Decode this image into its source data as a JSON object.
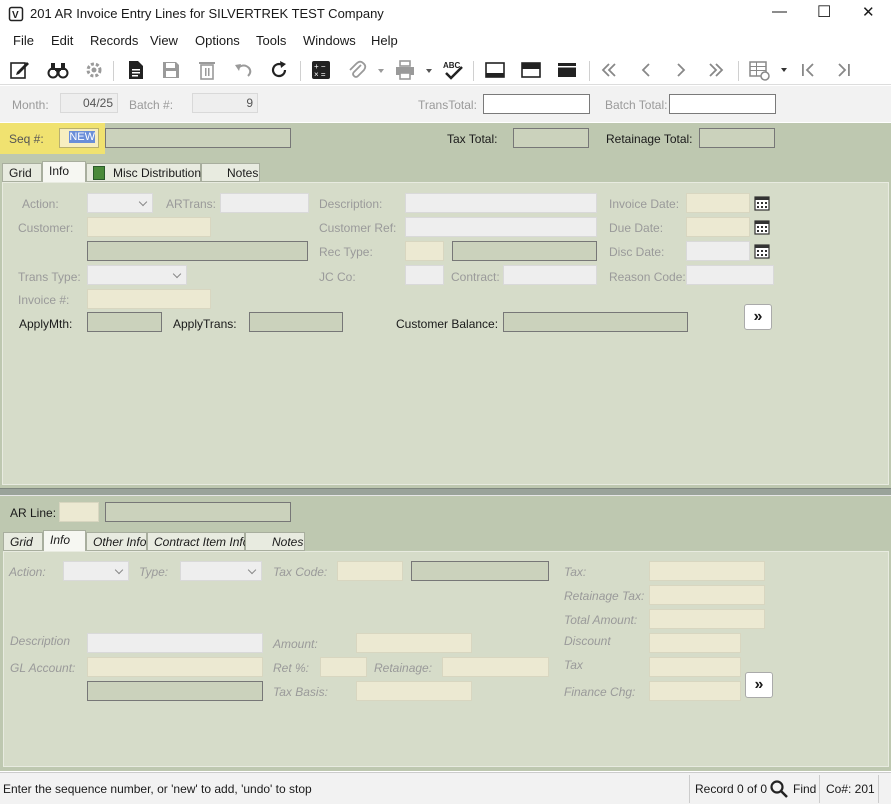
{
  "window": {
    "title": "201 AR Invoice Entry Lines for SILVERTREK TEST Company",
    "controls": {
      "minimize": "—",
      "maximize": "☐",
      "close": "✕"
    }
  },
  "menu": [
    "File",
    "Edit",
    "Records",
    "View",
    "Options",
    "Tools",
    "Windows",
    "Help"
  ],
  "toolbar_icons": [
    "edit-icon",
    "binoculars-icon",
    "gear-icon",
    "new-record-icon",
    "save-icon",
    "delete-icon",
    "undo-icon",
    "refresh-icon",
    "calculator-icon",
    "attach-icon",
    "print-icon",
    "spellcheck-icon",
    "layout-bottom-icon",
    "layout-top-icon",
    "layout-full-icon",
    "first-double-icon",
    "prev-icon",
    "next-icon",
    "last-double-icon",
    "grid-settings-icon",
    "first-record-icon",
    "last-record-icon"
  ],
  "batch": {
    "month_label": "Month:",
    "month_value": "04/25",
    "batch_label": "Batch #:",
    "batch_value": "9",
    "trans_total_label": "TransTotal:",
    "batch_total_label": "Batch Total:"
  },
  "header": {
    "seq_label": "Seq #:",
    "seq_value": "NEW",
    "tax_total_label": "Tax Total:",
    "retainage_total_label": "Retainage Total:"
  },
  "upper_tabs": [
    "Grid",
    "Info",
    "Misc Distributions",
    "Notes"
  ],
  "upper_form": {
    "action": "Action:",
    "artrans": "ARTrans:",
    "description": "Description:",
    "invoice_date": "Invoice Date:",
    "customer": "Customer:",
    "customer_ref": "Customer Ref:",
    "due_date": "Due Date:",
    "rec_type": "Rec Type:",
    "disc_date": "Disc Date:",
    "trans_type": "Trans Type:",
    "jc_co": "JC Co:",
    "contract": "Contract:",
    "reason_code": "Reason Code:",
    "invoice_no": "Invoice #:",
    "apply_mth": "ApplyMth:",
    "apply_trans": "ApplyTrans:",
    "customer_balance": "Customer Balance:",
    "more_button": "»"
  },
  "line": {
    "ar_line_label": "AR Line:"
  },
  "lower_tabs": [
    "Grid",
    "Info",
    "Other Info",
    "Contract Item Info",
    "Notes"
  ],
  "lower_form": {
    "action": "Action:",
    "type": "Type:",
    "tax_code": "Tax Code:",
    "tax": "Tax:",
    "retainage_tax": "Retainage Tax:",
    "total_amount": "Total Amount:",
    "description": "Description",
    "amount": "Amount:",
    "discount": "Discount",
    "gl_account": "GL Account:",
    "ret_pct": "Ret %:",
    "retainage": "Retainage:",
    "tax2": "Tax",
    "tax_basis": "Tax Basis:",
    "finance_chg": "Finance Chg:",
    "more_button": "»"
  },
  "status": {
    "message": "Enter the sequence number, or 'new' to add, 'undo' to stop",
    "record": "Record 0 of 0",
    "find": "Find",
    "company": "Co#: 201"
  }
}
